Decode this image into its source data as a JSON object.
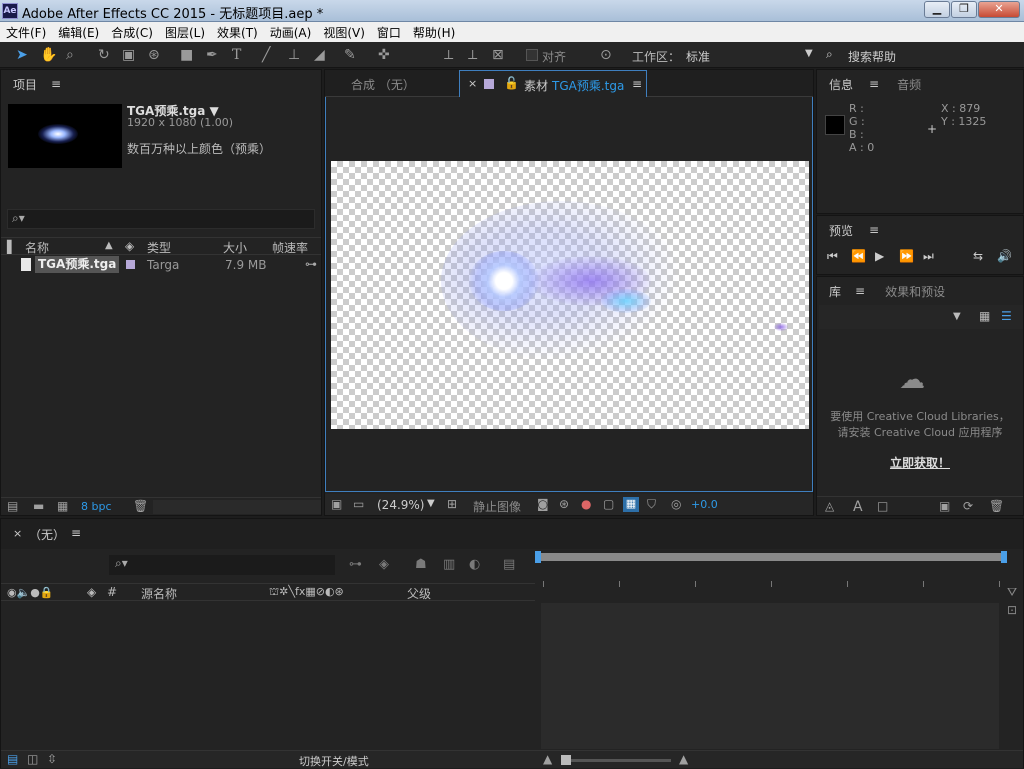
{
  "window": {
    "title": "Adobe After Effects CC 2015 - 无标题项目.aep *",
    "app_icon": "Ae"
  },
  "menu": [
    "文件(F)",
    "编辑(E)",
    "合成(C)",
    "图层(L)",
    "效果(T)",
    "动画(A)",
    "视图(V)",
    "窗口",
    "帮助(H)"
  ],
  "toolbar": {
    "snap_label": "对齐",
    "workspace_label": "工作区：",
    "workspace_value": "标准",
    "search_help": "搜索帮助"
  },
  "project": {
    "tab": "项目",
    "footage_name": "TGA预乘.tga ▼",
    "footage_dims": "1920 x 1080 (1.00)",
    "footage_colors": "数百万种以上颜色（预乘）",
    "columns": {
      "name": "名称",
      "type": "类型",
      "size": "大小",
      "fps": "帧速率"
    },
    "rows": [
      {
        "name": "TGA预乘.tga",
        "type": "Targa",
        "size": "7.9 MB"
      }
    ],
    "bpc": "8 bpc"
  },
  "viewer": {
    "tab_comp": "合成 （无）",
    "tab_footage_prefix": "素材",
    "tab_footage_name": "TGA预乘.tga",
    "zoom": "(24.9%)",
    "still_label": "静止图像",
    "exposure": "+0.0"
  },
  "info": {
    "tab": "信息",
    "tab2": "音频",
    "r": "R :",
    "g": "G :",
    "b": "B :",
    "a": "A : 0",
    "x": "X : 879",
    "y": "Y : 1325"
  },
  "preview": {
    "tab": "预览"
  },
  "library": {
    "tab": "库",
    "tab2": "效果和预设",
    "msg1": "要使用 Creative Cloud Libraries，",
    "msg2": "请安装 Creative Cloud 应用程序",
    "link": "立即获取！"
  },
  "timeline": {
    "tab": "（无）",
    "source_name": "源名称",
    "hash": "#",
    "parent": "父级",
    "toggle": "切换开关/模式"
  }
}
